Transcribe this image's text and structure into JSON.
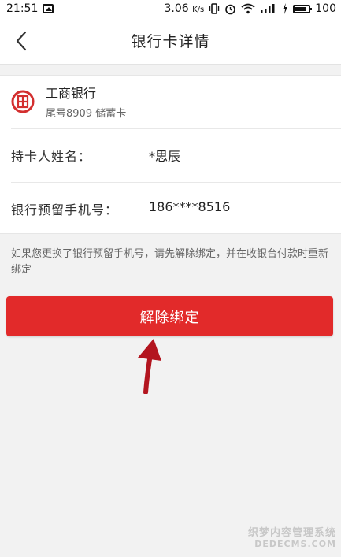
{
  "status_bar": {
    "time": "21:51",
    "network_speed": "3.06",
    "speed_unit": "K/s",
    "battery_level": "100",
    "battery_fraction": 1.0
  },
  "header": {
    "title": "银行卡详情",
    "back_icon": "chevron-left-icon"
  },
  "card": {
    "bank_name": "工商银行",
    "tail_text": "尾号8909  储蓄卡",
    "logo_color": "#d32f2f",
    "holder_label": "持卡人姓名：",
    "holder_value": "*思辰",
    "phone_label": "银行预留手机号：",
    "phone_value": "186****8516"
  },
  "notice": "如果您更换了银行预留手机号，请先解除绑定，并在收银台付款时重新绑定",
  "unbind_button": {
    "label": "解除绑定",
    "color": "#e22a2a"
  },
  "annotation": {
    "arrow_color": "#b3151f"
  },
  "watermark": {
    "line1": "织梦内容管理系统",
    "line2": "DEDECMS.COM"
  }
}
